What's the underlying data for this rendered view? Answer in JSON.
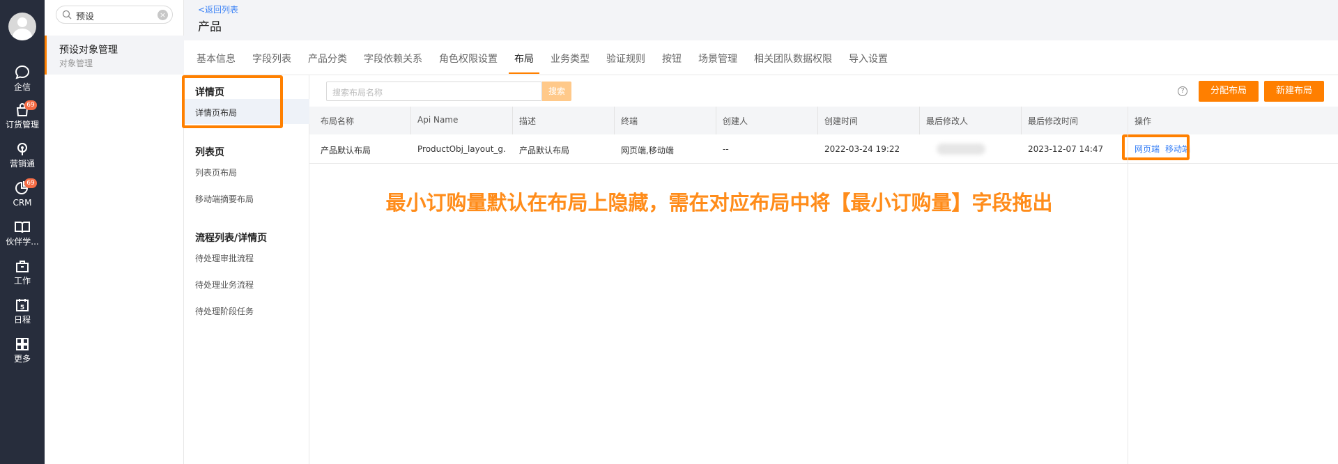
{
  "rail": {
    "items": [
      {
        "label": "企信",
        "icon": "chat-icon",
        "badge": ""
      },
      {
        "label": "订货管理",
        "icon": "bag-icon",
        "badge": "69"
      },
      {
        "label": "营销通",
        "icon": "broadcast-icon",
        "badge": ""
      },
      {
        "label": "CRM",
        "icon": "chart-pie-icon",
        "badge": "69"
      },
      {
        "label": "伙伴学...",
        "icon": "book-icon",
        "badge": ""
      },
      {
        "label": "工作",
        "icon": "briefcase-icon",
        "badge": ""
      },
      {
        "label": "日程",
        "icon": "calendar-icon",
        "badge": ""
      },
      {
        "label": "更多",
        "icon": "grid-icon",
        "badge": ""
      }
    ],
    "calendar_day": "5"
  },
  "panel2": {
    "search_value": "预设",
    "nav_title": "预设对象管理",
    "nav_sub": "对象管理"
  },
  "header": {
    "back": "<返回列表",
    "title": "产品"
  },
  "tabs": [
    "基本信息",
    "字段列表",
    "产品分类",
    "字段依赖关系",
    "角色权限设置",
    "布局",
    "业务类型",
    "验证规则",
    "按钮",
    "场景管理",
    "相关团队数据权限",
    "导入设置"
  ],
  "active_tab": "布局",
  "sections": {
    "detail_head": "详情页",
    "detail_items": [
      "详情页布局"
    ],
    "list_head": "列表页",
    "list_items": [
      "列表页布局",
      "移动端摘要布局"
    ],
    "flow_head": "流程列表/详情页",
    "flow_items": [
      "待处理审批流程",
      "待处理业务流程",
      "待处理阶段任务"
    ]
  },
  "toolbar": {
    "search_placeholder": "搜索布局名称",
    "search_btn": "搜索",
    "help": "?",
    "assign_btn": "分配布局",
    "new_btn": "新建布局"
  },
  "table": {
    "headers": [
      "布局名称",
      "Api Name",
      "描述",
      "终端",
      "创建人",
      "创建时间",
      "最后修改人",
      "最后修改时间",
      "操作"
    ],
    "row": {
      "name": "产品默认布局",
      "api": "ProductObj_layout_g...",
      "desc": "产品默认布局",
      "terminal": "网页端,移动端",
      "creator": "--",
      "created": "2022-03-24 19:22",
      "modified": "2023-12-07 14:47",
      "actions": [
        "网页端",
        "移动端"
      ]
    }
  },
  "annotation": "最小订购量默认在布局上隐藏，需在对应布局中将【最小订购量】字段拖出",
  "colors": {
    "accent": "#ff7f00",
    "rail": "#272d3c",
    "link": "#3b82f6",
    "annotation": "#ff8c1a"
  }
}
